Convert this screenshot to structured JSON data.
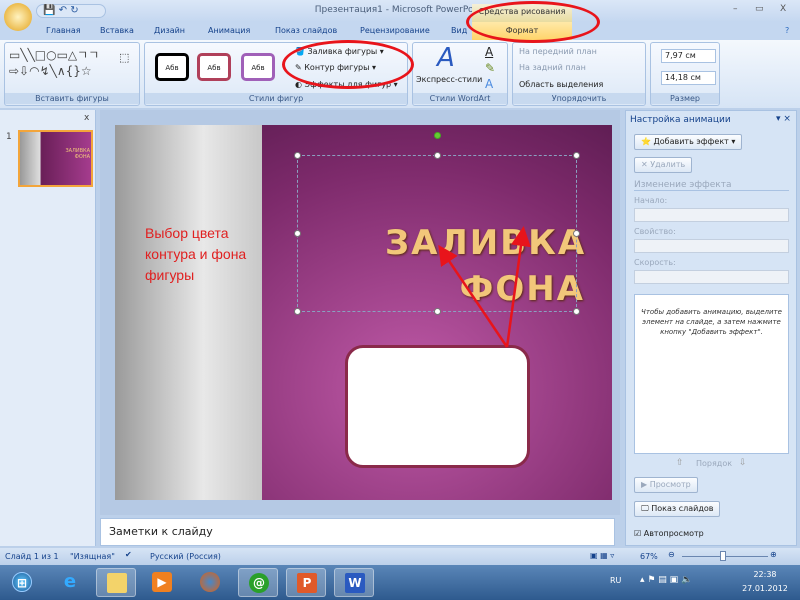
{
  "window": {
    "title": "Презентация1 - Microsoft PowerPoint",
    "min": "–",
    "max": "▭",
    "close": "X"
  },
  "tabs": [
    "Главная",
    "Вставка",
    "Дизайн",
    "Анимация",
    "Показ слайдов",
    "Рецензирование",
    "Вид"
  ],
  "context_tab": {
    "header": "Средства рисования",
    "tab": "Формат"
  },
  "ribbon": {
    "insert_shapes": {
      "label": "Вставить фигуры",
      "shapes": "▭╲╲□○▭△ㄱㄱ⇨⇩◠↯╲∧{}☆"
    },
    "shape_styles": {
      "label": "Стили фигур",
      "styles": [
        "Абв",
        "Абв",
        "Абв"
      ],
      "fill": "Заливка фигуры",
      "outline": "Контур фигуры",
      "effects": "Эффекты для фигур"
    },
    "wordart": {
      "label": "Стили WordArt",
      "express": "Экспресс-стили"
    },
    "arrange": {
      "label": "Упорядочить",
      "front": "На передний план",
      "back": "На задний план",
      "selection": "Область выделения"
    },
    "size": {
      "label": "Размер",
      "height": "7,97 см",
      "width": "14,18 см"
    }
  },
  "slide": {
    "title": "ЗАЛИВКА ФОНА",
    "thumb_title": "ЗАЛИВКА ФОНА",
    "number": "1"
  },
  "annotation": "Выбор цвета контура и фона фигуры",
  "notes": {
    "placeholder": "Заметки к слайду"
  },
  "task_pane": {
    "title": "Настройка анимации",
    "add_effect": "Добавить эффект",
    "delete": "Удалить",
    "section": "Изменение эффекта",
    "start": "Начало:",
    "property": "Свойство:",
    "speed": "Скорость:",
    "hint": "Чтобы добавить анимацию, выделите элемент на слайде, а затем нажмите кнопку \"Добавить эффект\".",
    "order": "Порядок",
    "preview": "Просмотр",
    "slideshow": "Показ слайдов",
    "autopreview": "Автопросмотр",
    "autopreview_checked": true
  },
  "status": {
    "slide": "Слайд 1 из 1",
    "theme": "\"Изящная\"",
    "language": "Русский (Россия)",
    "zoom": "67%"
  },
  "taskbar": {
    "lang": "RU",
    "time": "22:38",
    "date": "27.01.2012"
  },
  "colors": {
    "highlight_ring": "#e8141b",
    "slide_bg": "#7d2a6b",
    "title_gold": "#f2c77a",
    "shape_border": "#8a2a4a"
  }
}
